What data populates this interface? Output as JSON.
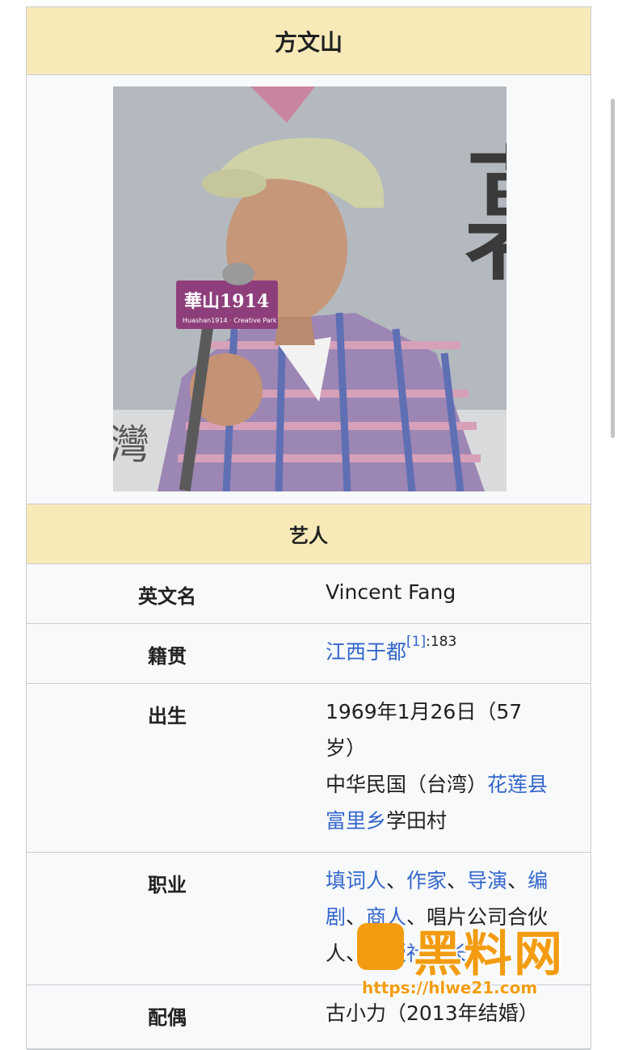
{
  "infobox": {
    "title": "方文山",
    "section_title": "艺人",
    "rows": {
      "english_name": {
        "label": "英文名",
        "value": "Vincent Fang"
      },
      "native_place": {
        "label": "籍贯",
        "link": "江西于都",
        "ref": "[1]",
        "page": ":183"
      },
      "birth": {
        "label": "出生",
        "line1": "1969年1月26日（57",
        "line2": "岁）",
        "line3_text": "中华民国（台湾）",
        "line3_link": "花莲县",
        "line4_link": "富里乡",
        "line4_text": "学田村"
      },
      "occupation": {
        "label": "职业",
        "items": [
          "填词人",
          "、",
          "作家",
          "、",
          "导演",
          "、",
          "编剧",
          "、",
          "商人",
          "、唱片公司合伙人、",
          "出版社社长"
        ]
      },
      "spouse": {
        "label": "配偶",
        "value": "古小力（2013年结婚）"
      }
    }
  },
  "photo": {
    "sign_text": "華山1914",
    "sign_subtext": "Huashan1914 · Creative Park",
    "bg_text": "幕",
    "bg_text2": "灣"
  },
  "watermark": {
    "brand": "黑料网",
    "url": "https://hlwe21.com"
  },
  "colors": {
    "header_bg": "#f8eab8",
    "link": "#3366cc",
    "border": "#c8ccd1",
    "watermark": "#f39c12"
  }
}
